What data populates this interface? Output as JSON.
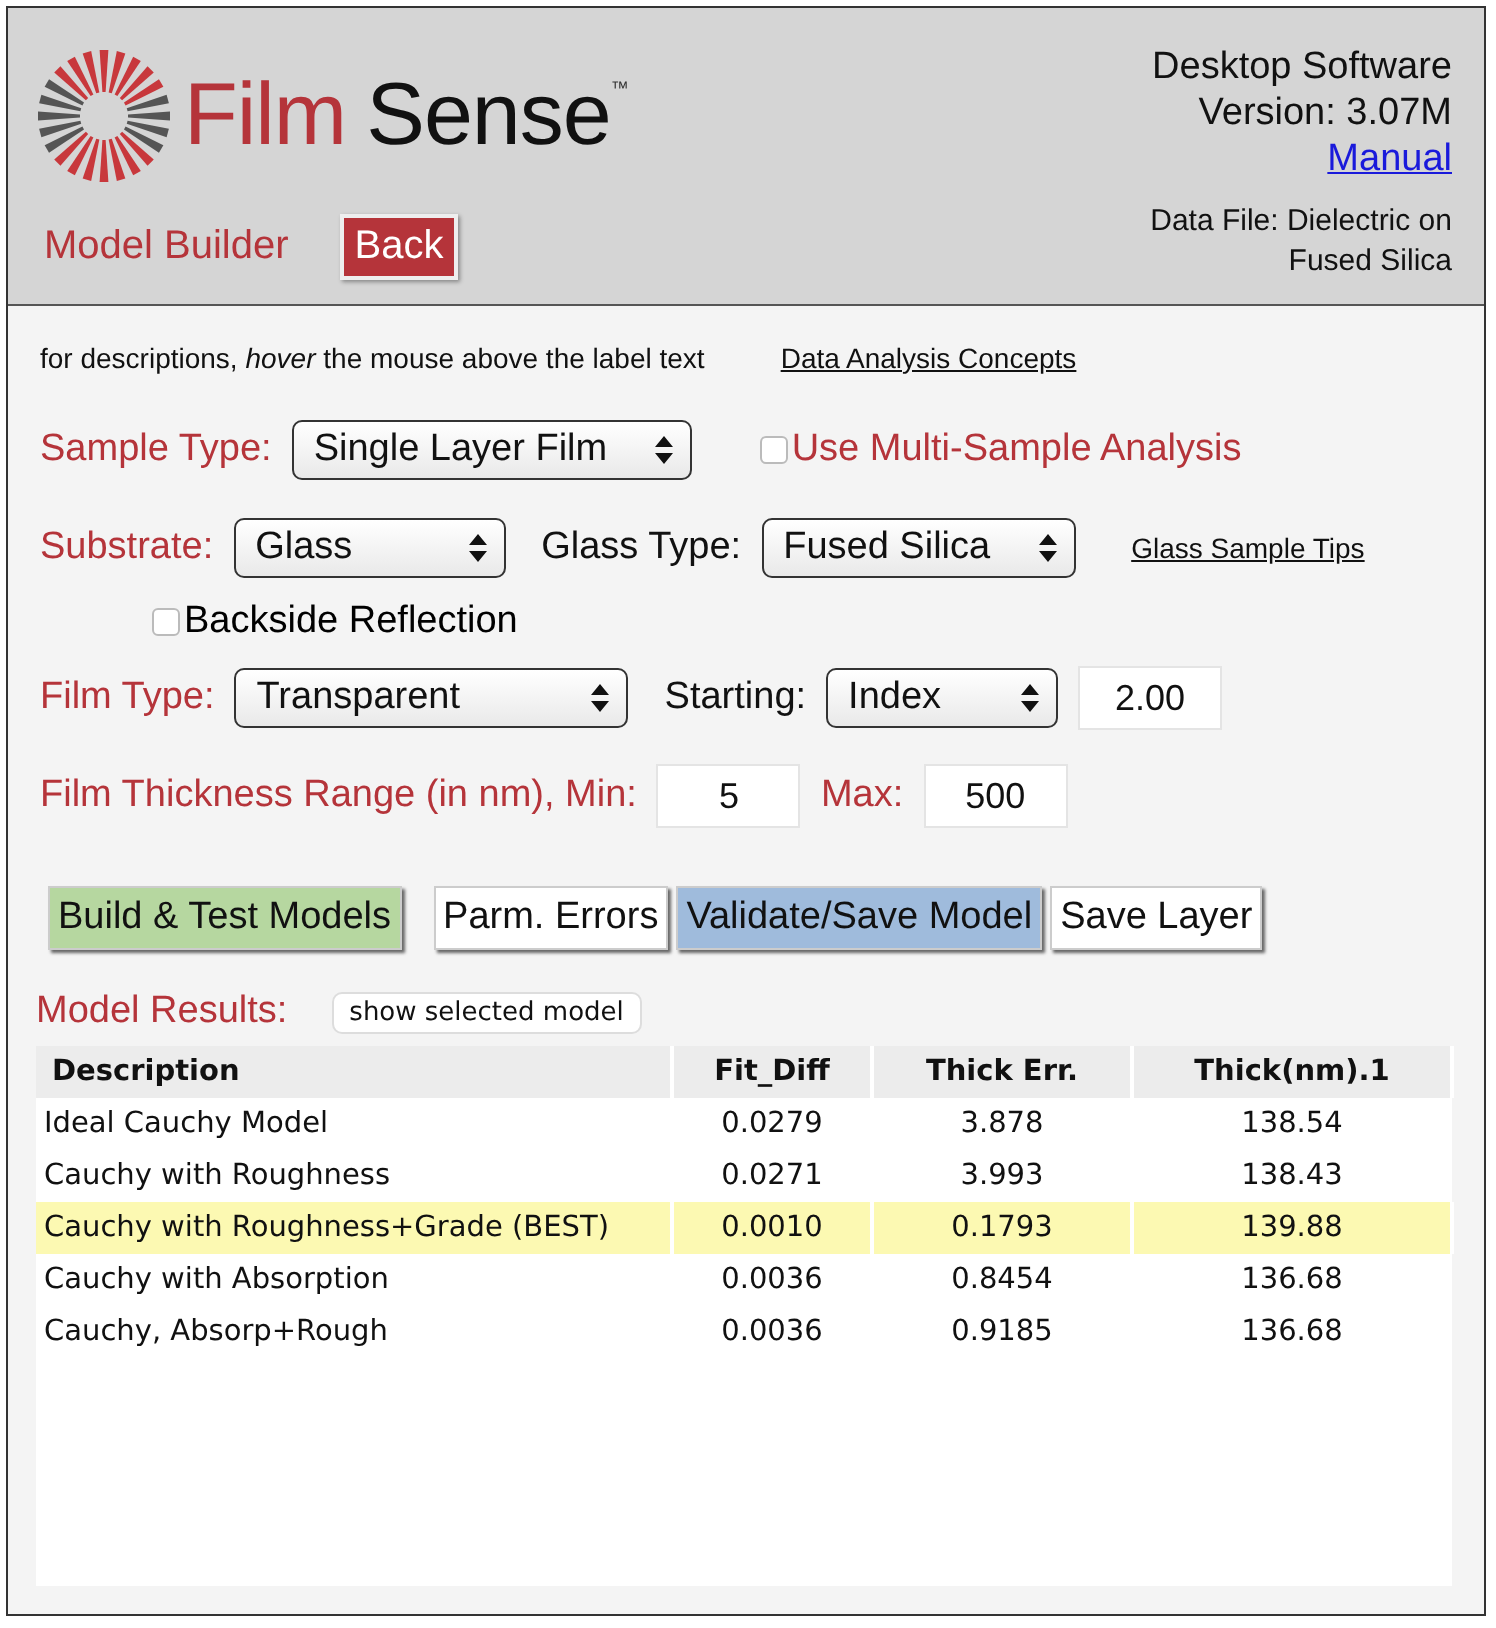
{
  "header": {
    "logo": {
      "word_1": "Film",
      "word_2": "Sense",
      "trademark": "™"
    },
    "page_title": "Model Builder",
    "back_button": "Back",
    "product": "Desktop Software",
    "version": "Version: 3.07M",
    "manual_link": "Manual",
    "data_file": "Data File: Dielectric on Fused Silica"
  },
  "hint": {
    "text": "for descriptions, *hover* the mouse above the label text",
    "link": "Data Analysis Concepts"
  },
  "form_rows": [
    [
      {
        "kind": "label",
        "text": "Sample Type:"
      },
      {
        "kind": "select",
        "value": "Single Layer Film"
      },
      {
        "kind": "toggle",
        "text": "Use Multi-Sample Analysis",
        "checked": false
      }
    ],
    [
      {
        "kind": "label",
        "text": "Substrate:"
      },
      {
        "kind": "select",
        "value": "Glass"
      },
      {
        "kind": "caption",
        "text": "Glass Type:"
      },
      {
        "kind": "select",
        "value": "Fused Silica"
      },
      {
        "kind": "link",
        "text": "Glass Sample Tips"
      }
    ],
    [
      {
        "kind": "checkbox",
        "text": "Backside Reflection",
        "checked": false
      }
    ],
    [
      {
        "kind": "label",
        "text": "Film Type:"
      },
      {
        "kind": "select",
        "value": "Transparent"
      },
      {
        "kind": "caption",
        "text": "Starting:"
      },
      {
        "kind": "select",
        "value": "Index"
      },
      {
        "kind": "input",
        "value": "2.00"
      }
    ],
    [
      {
        "kind": "label",
        "text": "Film Thickness Range (in nm), Min:"
      },
      {
        "kind": "input",
        "value": "5"
      },
      {
        "kind": "label",
        "text": "Max:"
      },
      {
        "kind": "input",
        "value": "500"
      }
    ]
  ],
  "buttons": [
    {
      "label": "Build & Test Models",
      "color": "#b6d7a0"
    },
    {
      "label": "Parm. Errors",
      "color": "#ffffff"
    },
    {
      "label": "Validate/Save Model",
      "color": "#9fbbdc"
    },
    {
      "label": "Save Layer",
      "color": "#ffffff"
    }
  ],
  "results": {
    "title": "Model Results:",
    "show_button": "show selected model",
    "columns": [
      "Description",
      "Fit_Diff",
      "Thick Err.",
      "Thick(nm).1"
    ],
    "rows": [
      {
        "cells": [
          "Ideal Cauchy Model",
          "0.0279",
          "3.878",
          "138.54"
        ],
        "selected": false
      },
      {
        "cells": [
          "Cauchy with Roughness",
          "0.0271",
          "3.993",
          "138.43"
        ],
        "selected": false
      },
      {
        "cells": [
          "Cauchy with Roughness+Grade (BEST)",
          "0.0010",
          "0.1793",
          "139.88"
        ],
        "selected": true
      },
      {
        "cells": [
          "Cauchy with Absorption",
          "0.0036",
          "0.8454",
          "136.68"
        ],
        "selected": false
      },
      {
        "cells": [
          "Cauchy, Absorp+Rough",
          "0.0036",
          "0.9185",
          "136.68"
        ],
        "selected": false
      }
    ]
  }
}
